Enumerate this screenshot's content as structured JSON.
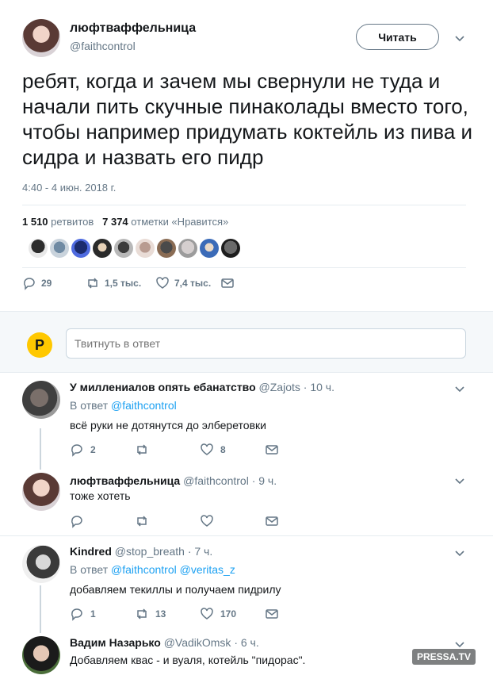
{
  "tweet": {
    "author_name": "люфтваффельница",
    "author_handle": "@faithcontrol",
    "follow_label": "Читать",
    "text": "ребят, когда и зачем мы свернули не туда и начали пить скучные пинаколады вместо того, чтобы например придумать коктейль из пива и сидра и назвать его пидр",
    "timestamp": "4:40 - 4 июн. 2018 г.",
    "retweets_count": "1 510",
    "retweets_label": "ретвитов",
    "likes_count": "7 374",
    "likes_label": "отметки «Нравится»",
    "reply_count": "29",
    "retweet_action": "1,5 тыс.",
    "like_action": "7,4 тыс."
  },
  "reply_box": {
    "placeholder": "Твитнуть в ответ",
    "avatar_letter": "P"
  },
  "replies": [
    {
      "name": "У миллениалов опять ебанатство",
      "handle": "@Zajots",
      "time": "· 10 ч.",
      "replying_label": "В ответ",
      "replying_to": "@faithcontrol",
      "text": "всё руки не дотянутся до элберетовки",
      "reply_count": "2",
      "retweet_count": "",
      "like_count": "8"
    },
    {
      "name": "люфтваффельница",
      "handle": "@faithcontrol",
      "time": "· 9 ч.",
      "text": "тоже хотеть",
      "reply_count": "",
      "retweet_count": "",
      "like_count": ""
    },
    {
      "name": "Kindred",
      "handle": "@stop_breath",
      "time": "· 7 ч.",
      "replying_label": "В ответ",
      "replying_to": "@faithcontrol @veritas_z",
      "text": "добавляем текиллы и получаем пидрилу",
      "reply_count": "1",
      "retweet_count": "13",
      "like_count": "170"
    },
    {
      "name": "Вадим Назарько",
      "handle": "@VadikOmsk",
      "time": "· 6 ч.",
      "text": "Добавляем квас - и вуаля, котейль \"пидорас\"."
    }
  ],
  "watermark": "PRESSA.TV",
  "colors": {
    "link": "#1da1f2",
    "muted": "#657786",
    "accent_avatar": "#ffc800"
  }
}
